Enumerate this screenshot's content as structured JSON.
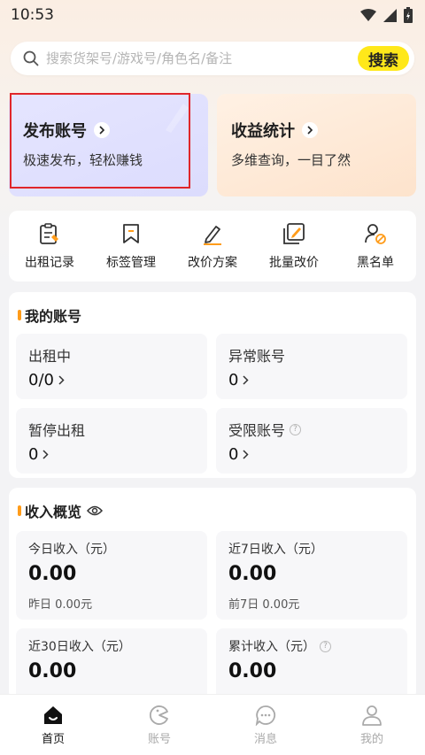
{
  "status_bar": {
    "time": "10:53"
  },
  "search": {
    "placeholder": "搜索货架号/游戏号/角色名/备注",
    "button_label": "搜索"
  },
  "banners": {
    "publish": {
      "title": "发布账号",
      "subtitle": "极速发布，轻松赚钱"
    },
    "income": {
      "title": "收益统计",
      "subtitle": "多维查询，一目了然"
    }
  },
  "tools": [
    {
      "label": "出租记录",
      "icon": "rental-record-icon"
    },
    {
      "label": "标签管理",
      "icon": "tag-icon"
    },
    {
      "label": "改价方案",
      "icon": "edit-pencil-icon"
    },
    {
      "label": "批量改价",
      "icon": "batch-edit-icon"
    },
    {
      "label": "黑名单",
      "icon": "blacklist-user-icon"
    }
  ],
  "accounts": {
    "title": "我的账号",
    "renting": {
      "label": "出租中",
      "value": "0/0"
    },
    "abnormal": {
      "label": "异常账号",
      "value": "0"
    },
    "paused": {
      "label": "暂停出租",
      "value": "0"
    },
    "restricted": {
      "label": "受限账号",
      "value": "0"
    }
  },
  "income": {
    "title": "收入概览",
    "today": {
      "label": "今日收入（元）",
      "value": "0.00",
      "compare": "昨日 0.00元"
    },
    "week": {
      "label": "近7日收入（元）",
      "value": "0.00",
      "compare": "前7日 0.00元"
    },
    "month": {
      "label": "近30日收入（元）",
      "value": "0.00"
    },
    "total": {
      "label": "累计收入（元）",
      "value": "0.00"
    }
  },
  "bottom_nav": [
    {
      "label": "首页",
      "active": true
    },
    {
      "label": "账号",
      "active": false
    },
    {
      "label": "消息",
      "active": false
    },
    {
      "label": "我的",
      "active": false
    }
  ],
  "colors": {
    "accent_yellow": "#ffe81a",
    "accent_orange": "#ff9c1a",
    "highlight_red": "#e0262a"
  }
}
